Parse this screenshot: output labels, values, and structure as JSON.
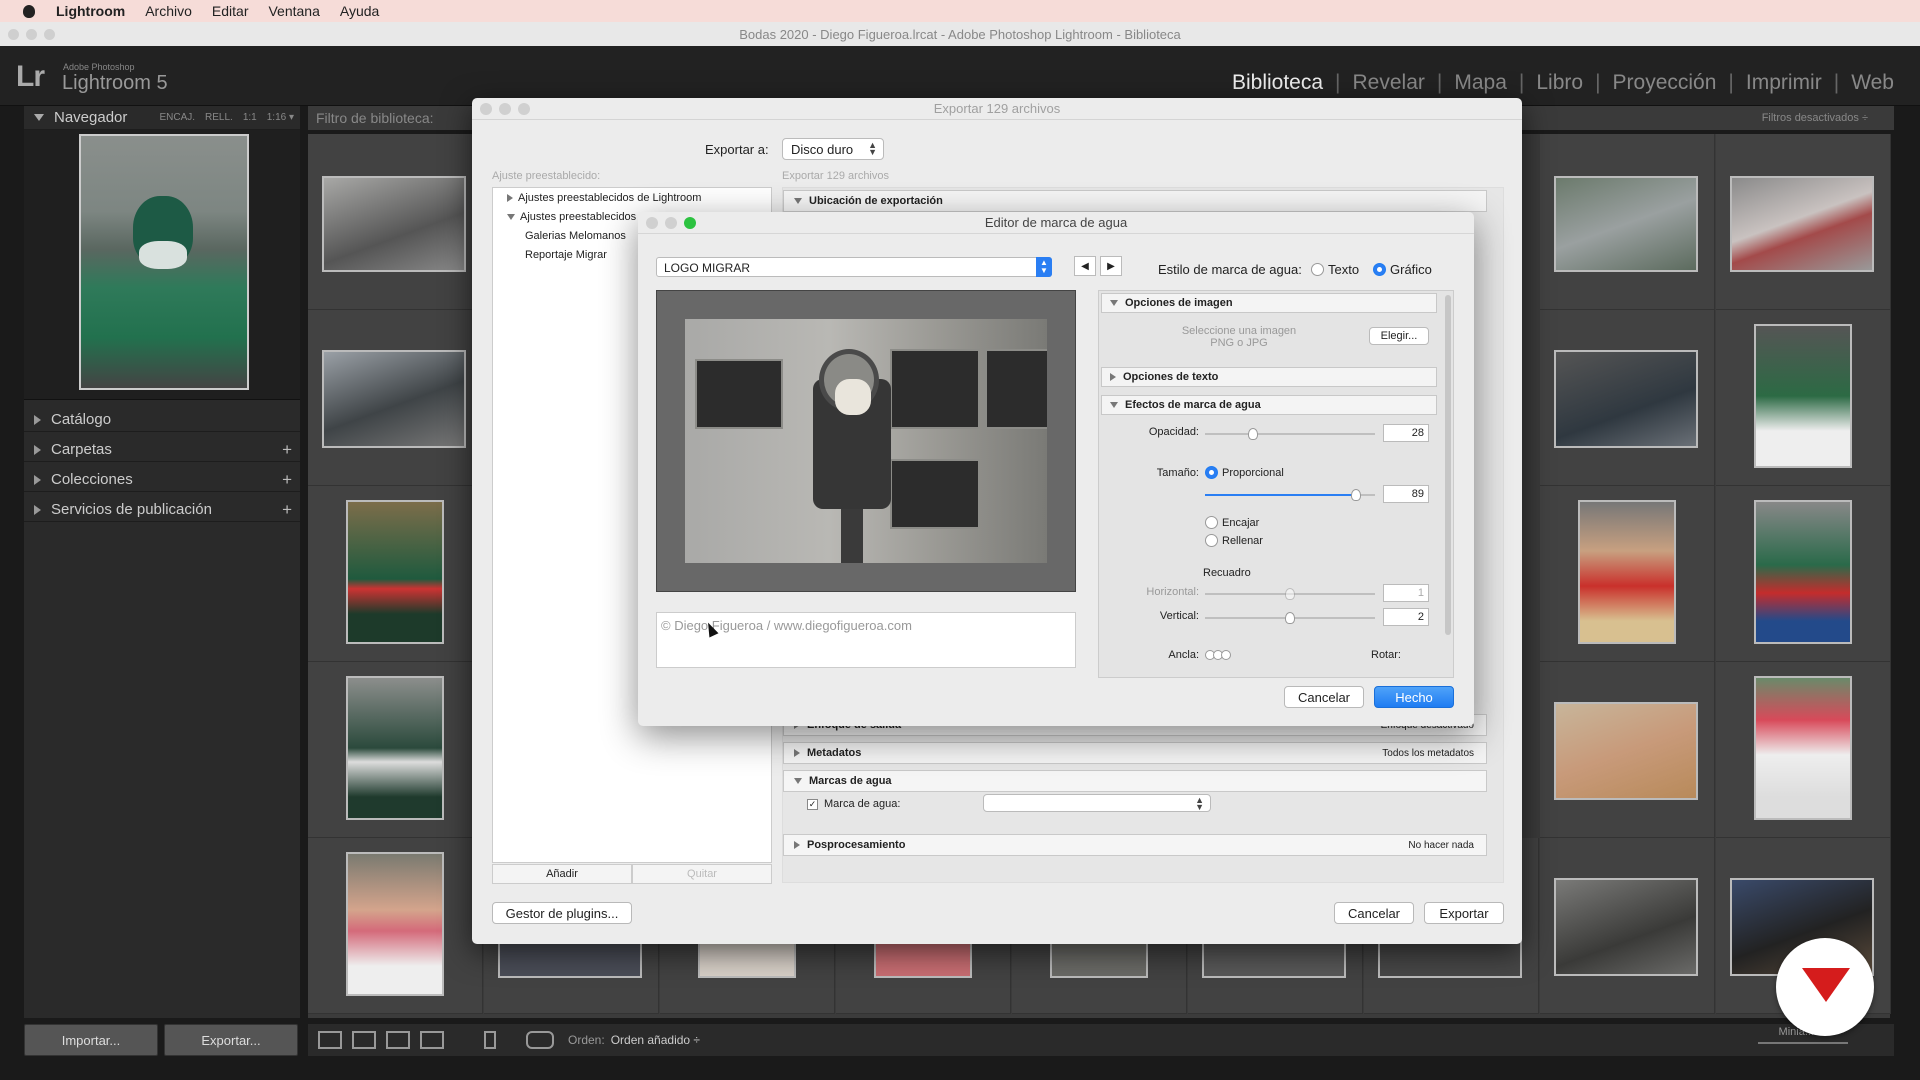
{
  "menubar": {
    "items": [
      "Lightroom",
      "Archivo",
      "Editar",
      "Ventana",
      "Ayuda"
    ]
  },
  "window": {
    "title": "Bodas 2020 - Diego Figueroa.lrcat - Adobe Photoshop Lightroom - Biblioteca"
  },
  "lr": {
    "brand_small": "Adobe Photoshop",
    "brand_name": "Lightroom 5",
    "modules": [
      "Biblioteca",
      "Revelar",
      "Mapa",
      "Libro",
      "Proyección",
      "Imprimir",
      "Web"
    ],
    "active_module": "Biblioteca"
  },
  "leftpanel": {
    "navigator": "Navegador",
    "nav_opts": [
      "ENCAJ.",
      "RELL.",
      "1:1",
      "1:16 ▾"
    ],
    "sections": [
      "Catálogo",
      "Carpetas",
      "Colecciones",
      "Servicios de publicación"
    ],
    "import": "Importar...",
    "export": "Exportar..."
  },
  "filterbar": {
    "title": "Filtro de biblioteca:",
    "right": "Filtros desactivados ÷"
  },
  "toolbar": {
    "sort_label": "Orden:",
    "sort_value": "Orden añadido ÷",
    "mini_label": "Minia..."
  },
  "export": {
    "title": "Exportar 129 archivos",
    "export_to_label": "Exportar a:",
    "export_to_value": "Disco duro",
    "preset_label": "Ajuste preestablecido:",
    "files_label": "Exportar 129 archivos",
    "tree": {
      "lr_presets": "Ajustes preestablecidos de Lightroom",
      "user_presets": "Ajustes preestablecidos",
      "children": [
        "Galerias Melomanos",
        "Reportaje Migrar"
      ]
    },
    "add": "Añadir",
    "remove": "Quitar",
    "sections": {
      "location": "Ubicación de exportación",
      "sharpen": "Enfoque de salida",
      "sharpen_val": "Enfoque desactivado",
      "metadata": "Metadatos",
      "metadata_val": "Todos los metadatos",
      "watermark": "Marcas de agua",
      "watermark_check": "Marca de agua:",
      "postprocess": "Posprocesamiento",
      "postprocess_val": "No hacer nada"
    },
    "plugins": "Gestor de plugins...",
    "cancel": "Cancelar",
    "export_btn": "Exportar"
  },
  "wm": {
    "title": "Editor de marca de agua",
    "preset": "LOGO MIGRAR",
    "style_label": "Estilo de marca de agua:",
    "style_text": "Texto",
    "style_graphic": "Gráfico",
    "text_content": "© Diego Figueroa / www.diegofigueroa.com",
    "image_options": "Opciones de imagen",
    "choose_hint_1": "Seleccione una imagen",
    "choose_hint_2": "PNG o JPG",
    "choose_btn": "Elegir...",
    "text_options": "Opciones de texto",
    "effects": "Efectos de marca de agua",
    "opacity_label": "Opacidad:",
    "opacity": 28,
    "size_label": "Tamaño:",
    "proportional": "Proporcional",
    "size": 89,
    "fit": "Encajar",
    "fill": "Rellenar",
    "inset_label": "Recuadro",
    "horizontal_label": "Horizontal:",
    "horizontal": 1,
    "vertical_label": "Vertical:",
    "vertical": 2,
    "anchor_label": "Ancla:",
    "rotate_label": "Rotar:",
    "cancel": "Cancelar",
    "done": "Hecho"
  }
}
